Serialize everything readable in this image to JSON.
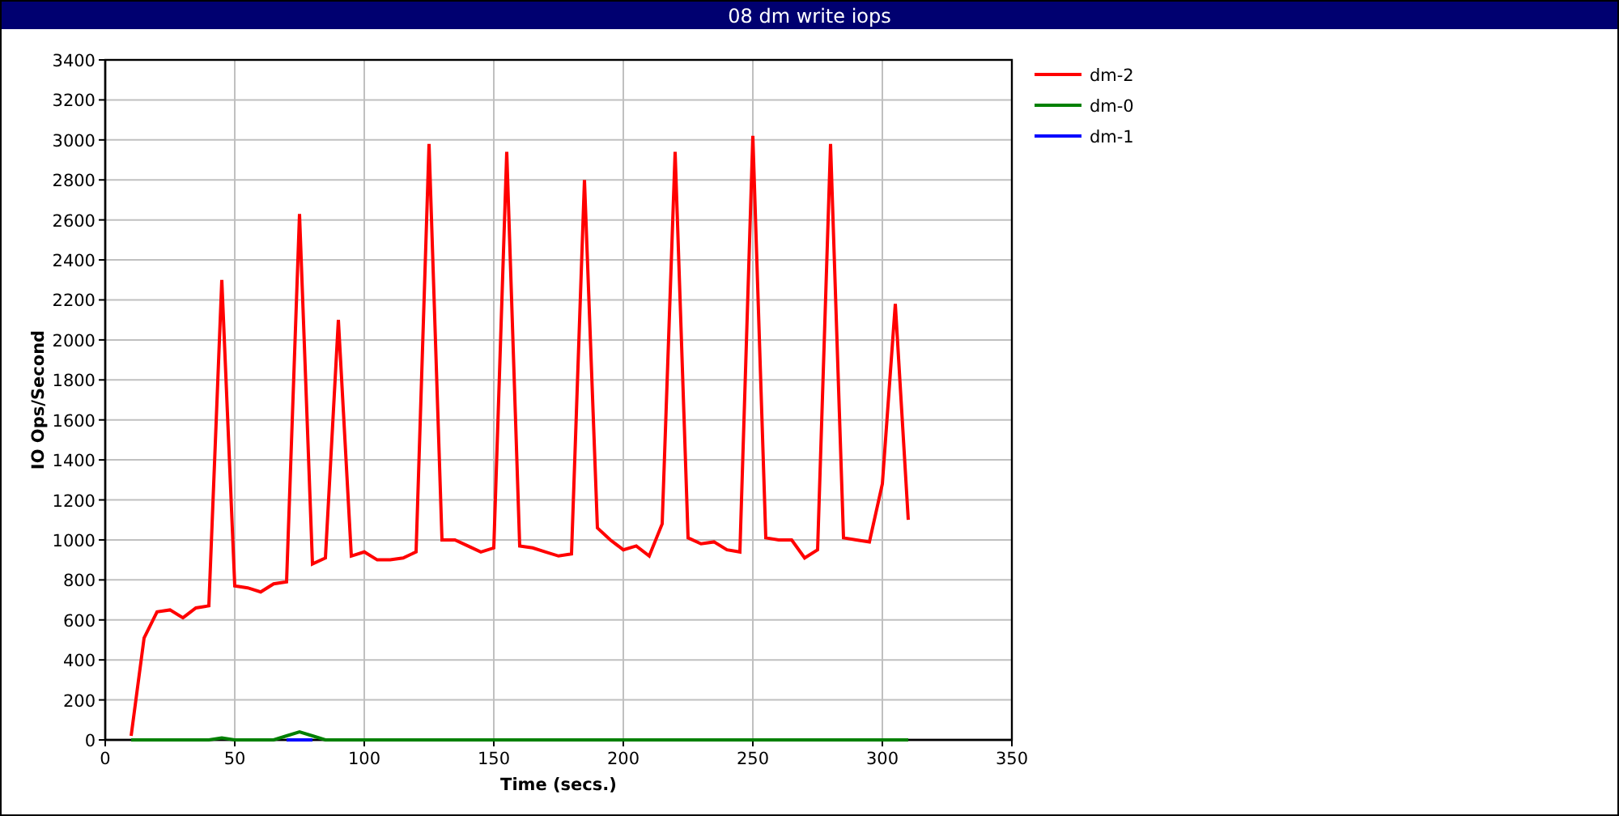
{
  "window": {
    "title": "08 dm write iops"
  },
  "chart": {
    "chart_data": {
      "type": "line",
      "xlabel": "Time (secs.)",
      "ylabel": "IO Ops/Second",
      "x": [
        10,
        15,
        20,
        25,
        30,
        35,
        40,
        45,
        50,
        55,
        60,
        65,
        70,
        75,
        80,
        85,
        90,
        95,
        100,
        105,
        110,
        115,
        120,
        125,
        130,
        135,
        140,
        145,
        150,
        155,
        160,
        165,
        170,
        175,
        180,
        185,
        190,
        195,
        200,
        205,
        210,
        215,
        220,
        225,
        230,
        235,
        240,
        245,
        250,
        255,
        260,
        265,
        270,
        275,
        280,
        285,
        290,
        295,
        300,
        305,
        310
      ],
      "series": [
        {
          "name": "dm-2",
          "color": "#ff0000",
          "values": [
            20,
            510,
            640,
            650,
            610,
            660,
            670,
            2300,
            770,
            760,
            740,
            780,
            790,
            2630,
            880,
            910,
            2100,
            920,
            940,
            900,
            900,
            910,
            940,
            2980,
            1000,
            1000,
            970,
            940,
            960,
            2940,
            970,
            960,
            940,
            920,
            930,
            2800,
            1060,
            1000,
            950,
            970,
            920,
            1080,
            2940,
            1010,
            980,
            990,
            950,
            940,
            3020,
            1010,
            1000,
            1000,
            910,
            950,
            2980,
            1010,
            1000,
            990,
            1280,
            2180,
            1100
          ]
        },
        {
          "name": "dm-0",
          "color": "#008000",
          "values": [
            0,
            0,
            0,
            0,
            0,
            0,
            0,
            10,
            0,
            0,
            0,
            0,
            20,
            40,
            20,
            0,
            0,
            0,
            0,
            0,
            0,
            0,
            0,
            0,
            0,
            0,
            0,
            0,
            0,
            0,
            0,
            0,
            0,
            0,
            0,
            0,
            0,
            0,
            0,
            0,
            0,
            0,
            0,
            0,
            0,
            0,
            0,
            0,
            0,
            0,
            0,
            0,
            0,
            0,
            0,
            0,
            0,
            0,
            0,
            0,
            0
          ]
        },
        {
          "name": "dm-1",
          "color": "#0000ff",
          "values": [
            null,
            null,
            null,
            null,
            null,
            null,
            null,
            null,
            null,
            null,
            null,
            null,
            0,
            0,
            0,
            null,
            null,
            null,
            null,
            null,
            null,
            null,
            null,
            null,
            null,
            null,
            null,
            null,
            null,
            null,
            null,
            null,
            null,
            null,
            null,
            null,
            null,
            null,
            null,
            null,
            null,
            null,
            null,
            null,
            null,
            null,
            null,
            null,
            null,
            null,
            null,
            null,
            null,
            null,
            null,
            null,
            null,
            null,
            null,
            null,
            null
          ]
        }
      ],
      "grid": true,
      "legend": true,
      "xlim": [
        0,
        350
      ],
      "ylim": [
        0,
        3400
      ],
      "xticks": [
        0,
        50,
        100,
        150,
        200,
        250,
        300,
        350
      ],
      "yticks": [
        0,
        200,
        400,
        600,
        800,
        1000,
        1200,
        1400,
        1600,
        1800,
        2000,
        2200,
        2400,
        2600,
        2800,
        3000,
        3200,
        3400
      ]
    }
  }
}
